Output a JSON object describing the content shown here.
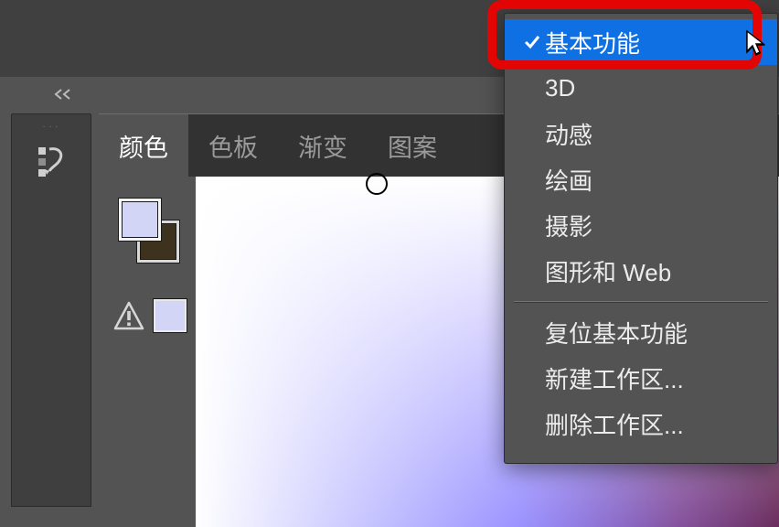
{
  "panel": {
    "tabs": [
      {
        "id": "color",
        "label": "颜色",
        "active": true
      },
      {
        "id": "swatches",
        "label": "色板",
        "active": false
      },
      {
        "id": "gradient",
        "label": "渐变",
        "active": false
      },
      {
        "id": "pattern",
        "label": "图案",
        "active": false
      }
    ]
  },
  "workspace_menu": {
    "selected_index": 0,
    "items": [
      {
        "id": "essentials",
        "label": "基本功能"
      },
      {
        "id": "three_d",
        "label": "3D"
      },
      {
        "id": "motion",
        "label": "动感"
      },
      {
        "id": "painting",
        "label": "绘画"
      },
      {
        "id": "photography",
        "label": "摄影"
      },
      {
        "id": "graphic_web",
        "label": "图形和 Web"
      }
    ],
    "actions": [
      {
        "id": "reset",
        "label": "复位基本功能"
      },
      {
        "id": "new",
        "label": "新建工作区..."
      },
      {
        "id": "delete",
        "label": "删除工作区..."
      }
    ]
  },
  "colors": {
    "foreground": "#d2d5f5",
    "background": "#3d321e",
    "last_swatch": "#d2d5f5"
  },
  "narrow_panel": {
    "tiny_label": "..."
  }
}
